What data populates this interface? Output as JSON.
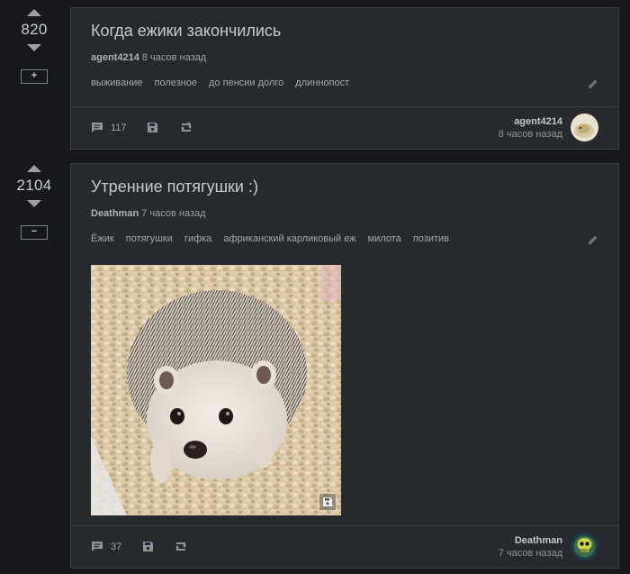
{
  "posts": [
    {
      "rating": "820",
      "toggle": "+",
      "title": "Когда ежики закончились",
      "author": "agent4214",
      "time": "8 часов назад",
      "tags": [
        "выживание",
        "полезное",
        "до пенсии долго",
        "длиннопост"
      ],
      "comments": "117",
      "footer_author": "agent4214",
      "footer_time": "8 часов назад"
    },
    {
      "rating": "2104",
      "toggle": "−",
      "title": "Утренние потягушки :)",
      "author": "Deathman",
      "time": "7 часов назад",
      "tags": [
        "Ёжик",
        "потягушки",
        "гифка",
        "африканский карликовый еж",
        "милота",
        "позитив"
      ],
      "comments": "37",
      "footer_author": "Deathman",
      "footer_time": "7 часов назад"
    }
  ],
  "icons": {
    "comment": "comment-icon",
    "save": "save-icon",
    "repost": "repost-icon",
    "edit": "pencil-icon"
  }
}
